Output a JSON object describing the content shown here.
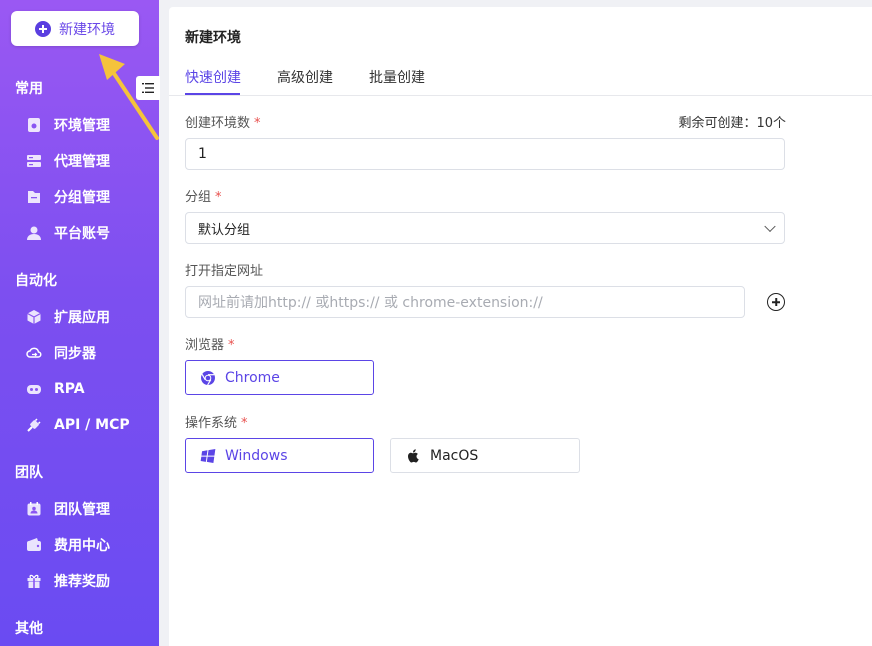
{
  "sidebar": {
    "new_env_label": "新建环境",
    "sections": [
      {
        "title": "常用",
        "items": [
          {
            "label": "环境管理",
            "icon": "environment-icon"
          },
          {
            "label": "代理管理",
            "icon": "proxy-icon"
          },
          {
            "label": "分组管理",
            "icon": "folder-icon"
          },
          {
            "label": "平台账号",
            "icon": "user-icon"
          }
        ]
      },
      {
        "title": "自动化",
        "items": [
          {
            "label": "扩展应用",
            "icon": "cube-icon"
          },
          {
            "label": "同步器",
            "icon": "sync-cloud-icon"
          },
          {
            "label": "RPA",
            "icon": "robot-icon"
          },
          {
            "label": "API / MCP",
            "icon": "plug-icon"
          }
        ]
      },
      {
        "title": "团队",
        "items": [
          {
            "label": "团队管理",
            "icon": "team-icon"
          },
          {
            "label": "费用中心",
            "icon": "wallet-icon"
          },
          {
            "label": "推荐奖励",
            "icon": "gift-icon"
          }
        ]
      },
      {
        "title": "其他",
        "items": []
      }
    ]
  },
  "main": {
    "title": "新建环境",
    "tabs": [
      {
        "label": "快速创建",
        "active": true
      },
      {
        "label": "高级创建",
        "active": false
      },
      {
        "label": "批量创建",
        "active": false
      }
    ],
    "form": {
      "count_label": "创建环境数",
      "required_mark": "*",
      "remaining": "剩余可创建：10个",
      "count_value": "1",
      "group_label": "分组",
      "group_value": "默认分组",
      "url_label": "打开指定网址",
      "url_placeholder": "网址前请加http:// 或https:// 或 chrome-extension://",
      "browser_label": "浏览器",
      "browser_option": "Chrome",
      "os_label": "操作系统",
      "os_options": [
        {
          "label": "Windows",
          "selected": true
        },
        {
          "label": "MacOS",
          "selected": false
        }
      ]
    }
  },
  "colors": {
    "accent": "#5b45e6",
    "sidebar_top": "#9a58f3",
    "sidebar_bottom": "#6a4bf2",
    "required": "#e8504d",
    "arrow": "#f5c33b"
  }
}
